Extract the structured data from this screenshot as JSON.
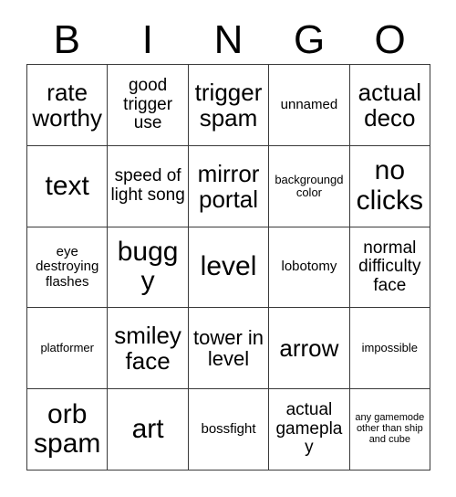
{
  "header": {
    "letters": [
      "B",
      "I",
      "N",
      "G",
      "O"
    ]
  },
  "grid": {
    "rows": [
      [
        {
          "text": "rate worthy",
          "size": "fs-xl"
        },
        {
          "text": "good trigger use",
          "size": "fs-md"
        },
        {
          "text": "trigger spam",
          "size": "fs-xl"
        },
        {
          "text": "unnamed",
          "size": "fs-sm"
        },
        {
          "text": "actual deco",
          "size": "fs-xl"
        }
      ],
      [
        {
          "text": "text",
          "size": "fs-xxl"
        },
        {
          "text": "speed of light song",
          "size": "fs-md"
        },
        {
          "text": "mirror portal",
          "size": "fs-xl"
        },
        {
          "text": "backgroungd color",
          "size": "fs-xs"
        },
        {
          "text": "no clicks",
          "size": "fs-xxl"
        }
      ],
      [
        {
          "text": "eye destroying flashes",
          "size": "fs-sm"
        },
        {
          "text": "buggy",
          "size": "fs-xxl"
        },
        {
          "text": "level",
          "size": "fs-xxl"
        },
        {
          "text": "lobotomy",
          "size": "fs-sm"
        },
        {
          "text": "normal difficulty face",
          "size": "fs-md"
        }
      ],
      [
        {
          "text": "platformer",
          "size": "fs-xs"
        },
        {
          "text": "smiley face",
          "size": "fs-xl"
        },
        {
          "text": "tower in level",
          "size": "fs-lg"
        },
        {
          "text": "arrow",
          "size": "fs-xl"
        },
        {
          "text": "impossible",
          "size": "fs-xs"
        }
      ],
      [
        {
          "text": "orb spam",
          "size": "fs-xxl"
        },
        {
          "text": "art",
          "size": "fs-xxl"
        },
        {
          "text": "bossfight",
          "size": "fs-sm"
        },
        {
          "text": "actual gameplay",
          "size": "fs-md"
        },
        {
          "text": "any gamemode other than ship and cube",
          "size": "fs-xxs"
        }
      ]
    ]
  }
}
